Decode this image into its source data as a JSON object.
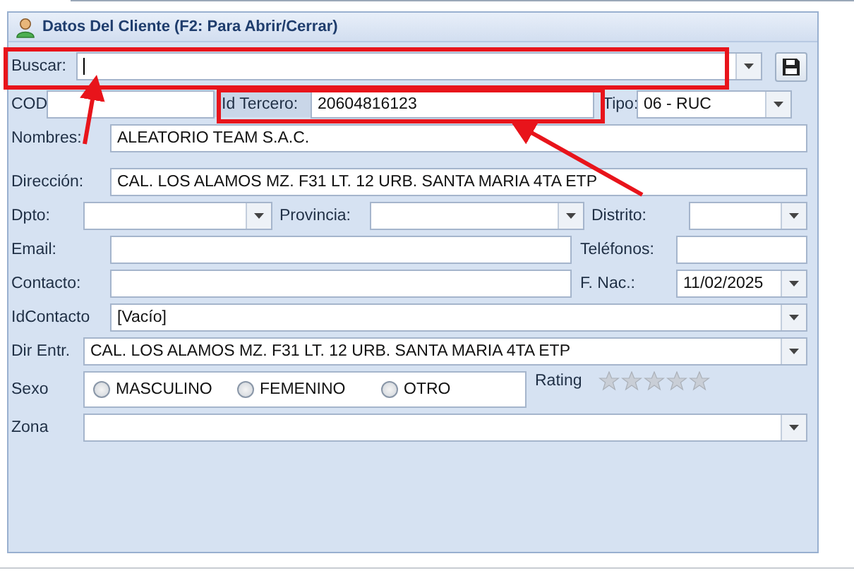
{
  "title": "Datos Del Cliente (F2: Para Abrir/Cerrar)",
  "buscar": {
    "label": "Buscar:"
  },
  "cod": {
    "label": "COD"
  },
  "id_tercero": {
    "label": "Id Tercero:",
    "value": "20604816123"
  },
  "tipo": {
    "label": "Tipo:",
    "value": "06 - RUC"
  },
  "nombres": {
    "label": "Nombres:",
    "value": "ALEATORIO TEAM S.A.C."
  },
  "direccion": {
    "label": "Dirección:",
    "value": "CAL. LOS ALAMOS MZ. F31 LT.  12 URB. SANTA MARIA 4TA ETP"
  },
  "dpto": {
    "label": "Dpto:"
  },
  "provincia": {
    "label": "Provincia:"
  },
  "distrito": {
    "label": "Distrito:"
  },
  "email": {
    "label": "Email:"
  },
  "telefonos": {
    "label": "Teléfonos:"
  },
  "contacto": {
    "label": "Contacto:"
  },
  "f_nac": {
    "label": "F. Nac.:",
    "value": "11/02/2025"
  },
  "id_contacto": {
    "label": "IdContacto",
    "value": "[Vacío]"
  },
  "dir_entr": {
    "label": "Dir Entr.",
    "value": "CAL. LOS ALAMOS MZ. F31 LT.  12 URB. SANTA MARIA 4TA ETP"
  },
  "sexo": {
    "label": "Sexo",
    "options": [
      {
        "label": "MASCULINO",
        "selected": false
      },
      {
        "label": "FEMENINO",
        "selected": false
      },
      {
        "label": "OTRO",
        "selected": false
      }
    ]
  },
  "rating": {
    "label": "Rating",
    "stars": 0
  },
  "zona": {
    "label": "Zona"
  }
}
